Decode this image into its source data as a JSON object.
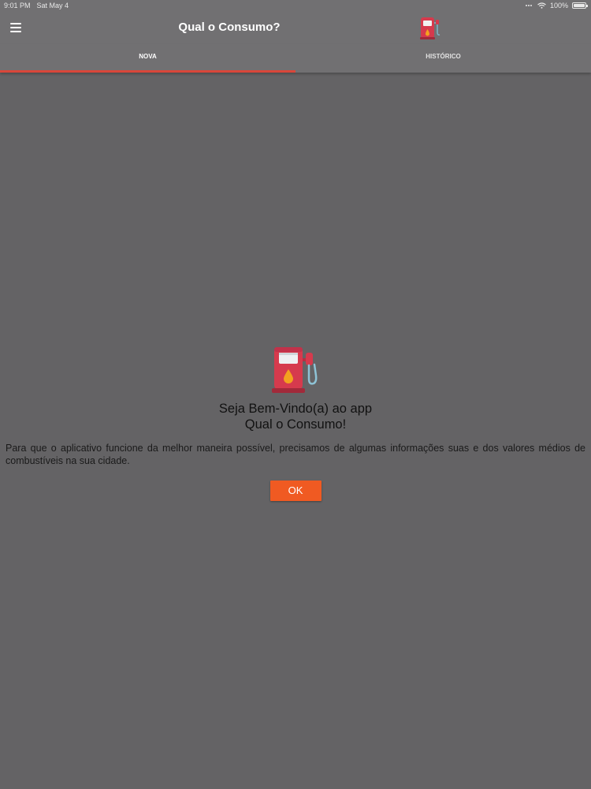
{
  "status_bar": {
    "time": "9:01 PM",
    "date": "Sat May 4",
    "battery": "100%",
    "battery_level": 1.0
  },
  "app_bar": {
    "title": "Qual o Consumo?",
    "menu_icon": "hamburger-menu-icon",
    "header_icon": "fuel-pump-icon"
  },
  "tabs": [
    {
      "label": "NOVA",
      "active": true
    },
    {
      "label": "HISTÓRICO",
      "active": false
    }
  ],
  "welcome": {
    "icon": "fuel-pump-icon",
    "title_line1": "Seja Bem-Vindo(a) ao app",
    "title_line2": "Qual o Consumo!",
    "body": "Para que o aplicativo funcione da melhor maneira possível, precisamos de algumas informações suas e dos valores médios  de combustíveis na sua cidade.",
    "ok_label": "OK"
  },
  "colors": {
    "background": "#646365",
    "app_bar": "#717072",
    "tab_indicator": "#d9473a",
    "ok_button": "#f05a22",
    "pump_red": "#d63a4d"
  }
}
